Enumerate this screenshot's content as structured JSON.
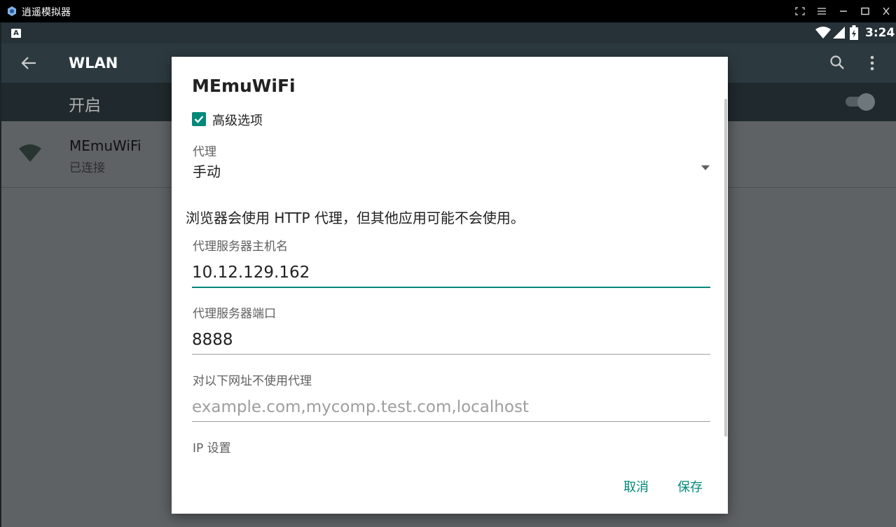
{
  "window": {
    "title": "逍遥模拟器"
  },
  "status_bar": {
    "notification": "A",
    "time": "3:24"
  },
  "app_bar": {
    "title": "WLAN"
  },
  "switch_bar": {
    "label": "开启",
    "enabled": true
  },
  "network": {
    "name": "MEmuWiFi",
    "status": "已连接"
  },
  "dialog": {
    "title": "MEmuWiFi",
    "advanced": {
      "label": "高级选项",
      "checked": true
    },
    "proxy": {
      "label": "代理",
      "value": "手动"
    },
    "info": "浏览器会使用 HTTP 代理，但其他应用可能不会使用。",
    "host": {
      "label": "代理服务器主机名",
      "value": "10.12.129.162"
    },
    "port": {
      "label": "代理服务器端口",
      "value": "8888"
    },
    "bypass": {
      "label": "对以下网址不使用代理",
      "placeholder": "example.com,mycomp.test.com,localhost"
    },
    "ip_settings": {
      "label": "IP 设置"
    },
    "cancel": "取消",
    "save": "保存"
  },
  "colors": {
    "accent": "#00897b",
    "status_bar": "#263238",
    "app_bar": "#2c3a40"
  }
}
